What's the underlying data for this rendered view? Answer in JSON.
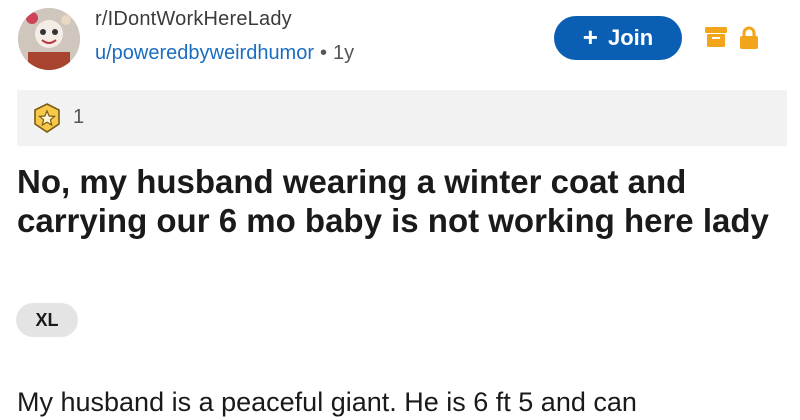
{
  "header": {
    "subreddit": "r/IDontWorkHereLady",
    "username": "u/poweredbyweirdhumor",
    "separator": "•",
    "age": "1y",
    "join_label": "Join",
    "join_plus": "+"
  },
  "awards": {
    "icon": "star-badge-icon",
    "count": "1"
  },
  "post": {
    "title": "No, my husband wearing a winter coat and carrying our 6 mo baby is not working here lady",
    "flair": "XL",
    "body_preview": "My husband is a peaceful giant. He is 6 ft 5 and can"
  },
  "colors": {
    "join_button": "#0a5fb4",
    "username": "#1a6dbf",
    "status_icons": "#f2a51a",
    "award_bar": "#f2f2f2",
    "flair_bg": "#e4e4e4"
  },
  "status_icons": [
    "archived-box-icon",
    "lock-icon"
  ]
}
